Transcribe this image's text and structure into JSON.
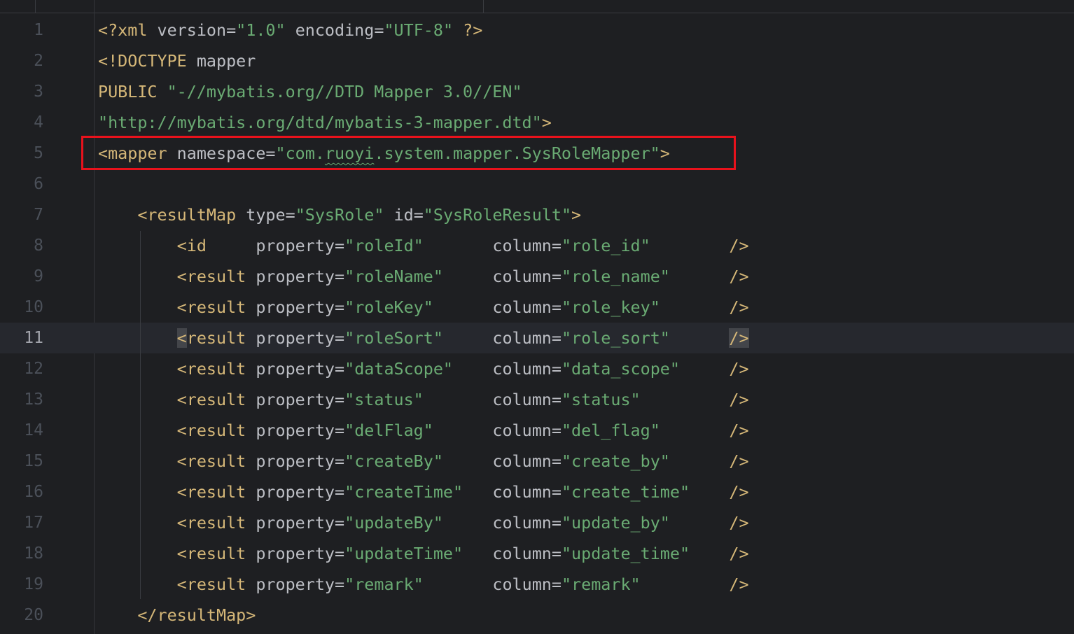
{
  "editor": {
    "lines": [
      {
        "num": "1",
        "tokens": [
          [
            "tag",
            "<?xml "
          ],
          [
            "attr",
            "version"
          ],
          [
            "txt",
            "="
          ],
          [
            "val",
            "\"1.0\""
          ],
          [
            "txt",
            " "
          ],
          [
            "attr",
            "encoding"
          ],
          [
            "txt",
            "="
          ],
          [
            "val",
            "\"UTF-8\""
          ],
          [
            "txt",
            " "
          ],
          [
            "tag",
            "?>"
          ]
        ]
      },
      {
        "num": "2",
        "tokens": [
          [
            "tag",
            "<!DOCTYPE "
          ],
          [
            "txt",
            "mapper"
          ]
        ]
      },
      {
        "num": "3",
        "tokens": [
          [
            "tag",
            "PUBLIC "
          ],
          [
            "val",
            "\"-//mybatis.org//DTD Mapper 3.0//EN\""
          ]
        ]
      },
      {
        "num": "4",
        "tokens": [
          [
            "val",
            "\"http://mybatis.org/dtd/mybatis-3-mapper.dtd\""
          ],
          [
            "tag",
            ">"
          ]
        ]
      },
      {
        "num": "5",
        "tokens": [
          [
            "tag",
            "<mapper "
          ],
          [
            "attr",
            "namespace"
          ],
          [
            "txt",
            "="
          ],
          [
            "val",
            "\"com."
          ],
          [
            "typo",
            "ruoyi"
          ],
          [
            "val",
            ".system.mapper.SysRoleMapper\""
          ],
          [
            "tag",
            ">"
          ]
        ]
      },
      {
        "num": "6",
        "tokens": []
      },
      {
        "num": "7",
        "tokens": [
          [
            "txt",
            "    "
          ],
          [
            "tag",
            "<resultMap "
          ],
          [
            "attr",
            "type"
          ],
          [
            "txt",
            "="
          ],
          [
            "val",
            "\"SysRole\""
          ],
          [
            "txt",
            " "
          ],
          [
            "attr",
            "id"
          ],
          [
            "txt",
            "="
          ],
          [
            "val",
            "\"SysRoleResult\""
          ],
          [
            "tag",
            ">"
          ]
        ]
      },
      {
        "num": "8",
        "tokens": [
          [
            "txt",
            "        "
          ],
          [
            "tag",
            "<id     "
          ],
          [
            "attr",
            "property"
          ],
          [
            "txt",
            "="
          ],
          [
            "val",
            "\"roleId\"       "
          ],
          [
            "attr",
            "column"
          ],
          [
            "txt",
            "="
          ],
          [
            "val",
            "\"role_id\"        "
          ],
          [
            "tag",
            "/>"
          ]
        ]
      },
      {
        "num": "9",
        "tokens": [
          [
            "txt",
            "        "
          ],
          [
            "tag",
            "<result "
          ],
          [
            "attr",
            "property"
          ],
          [
            "txt",
            "="
          ],
          [
            "val",
            "\"roleName\"     "
          ],
          [
            "attr",
            "column"
          ],
          [
            "txt",
            "="
          ],
          [
            "val",
            "\"role_name\"      "
          ],
          [
            "tag",
            "/>"
          ]
        ]
      },
      {
        "num": "10",
        "tokens": [
          [
            "txt",
            "        "
          ],
          [
            "tag",
            "<result "
          ],
          [
            "attr",
            "property"
          ],
          [
            "txt",
            "="
          ],
          [
            "val",
            "\"roleKey\"      "
          ],
          [
            "attr",
            "column"
          ],
          [
            "txt",
            "="
          ],
          [
            "val",
            "\"role_key\"       "
          ],
          [
            "tag",
            "/>"
          ]
        ]
      },
      {
        "num": "11",
        "current": true,
        "tokens": [
          [
            "txt",
            "        "
          ],
          [
            "tagh",
            "<"
          ],
          [
            "tag",
            "result "
          ],
          [
            "attr",
            "property"
          ],
          [
            "txt",
            "="
          ],
          [
            "val",
            "\"roleSort\"     "
          ],
          [
            "attr",
            "column"
          ],
          [
            "txt",
            "="
          ],
          [
            "val",
            "\"role_sort\"      "
          ],
          [
            "tagh",
            "/>"
          ]
        ]
      },
      {
        "num": "12",
        "tokens": [
          [
            "txt",
            "        "
          ],
          [
            "tag",
            "<result "
          ],
          [
            "attr",
            "property"
          ],
          [
            "txt",
            "="
          ],
          [
            "val",
            "\"dataScope\"    "
          ],
          [
            "attr",
            "column"
          ],
          [
            "txt",
            "="
          ],
          [
            "val",
            "\"data_scope\"     "
          ],
          [
            "tag",
            "/>"
          ]
        ]
      },
      {
        "num": "13",
        "tokens": [
          [
            "txt",
            "        "
          ],
          [
            "tag",
            "<result "
          ],
          [
            "attr",
            "property"
          ],
          [
            "txt",
            "="
          ],
          [
            "val",
            "\"status\"       "
          ],
          [
            "attr",
            "column"
          ],
          [
            "txt",
            "="
          ],
          [
            "val",
            "\"status\"         "
          ],
          [
            "tag",
            "/>"
          ]
        ]
      },
      {
        "num": "14",
        "tokens": [
          [
            "txt",
            "        "
          ],
          [
            "tag",
            "<result "
          ],
          [
            "attr",
            "property"
          ],
          [
            "txt",
            "="
          ],
          [
            "val",
            "\"delFlag\"      "
          ],
          [
            "attr",
            "column"
          ],
          [
            "txt",
            "="
          ],
          [
            "val",
            "\"del_flag\"       "
          ],
          [
            "tag",
            "/>"
          ]
        ]
      },
      {
        "num": "15",
        "tokens": [
          [
            "txt",
            "        "
          ],
          [
            "tag",
            "<result "
          ],
          [
            "attr",
            "property"
          ],
          [
            "txt",
            "="
          ],
          [
            "val",
            "\"createBy\"     "
          ],
          [
            "attr",
            "column"
          ],
          [
            "txt",
            "="
          ],
          [
            "val",
            "\"create_by\"      "
          ],
          [
            "tag",
            "/>"
          ]
        ]
      },
      {
        "num": "16",
        "tokens": [
          [
            "txt",
            "        "
          ],
          [
            "tag",
            "<result "
          ],
          [
            "attr",
            "property"
          ],
          [
            "txt",
            "="
          ],
          [
            "val",
            "\"createTime\"   "
          ],
          [
            "attr",
            "column"
          ],
          [
            "txt",
            "="
          ],
          [
            "val",
            "\"create_time\"    "
          ],
          [
            "tag",
            "/>"
          ]
        ]
      },
      {
        "num": "17",
        "tokens": [
          [
            "txt",
            "        "
          ],
          [
            "tag",
            "<result "
          ],
          [
            "attr",
            "property"
          ],
          [
            "txt",
            "="
          ],
          [
            "val",
            "\"updateBy\"     "
          ],
          [
            "attr",
            "column"
          ],
          [
            "txt",
            "="
          ],
          [
            "val",
            "\"update_by\"      "
          ],
          [
            "tag",
            "/>"
          ]
        ]
      },
      {
        "num": "18",
        "tokens": [
          [
            "txt",
            "        "
          ],
          [
            "tag",
            "<result "
          ],
          [
            "attr",
            "property"
          ],
          [
            "txt",
            "="
          ],
          [
            "val",
            "\"updateTime\"   "
          ],
          [
            "attr",
            "column"
          ],
          [
            "txt",
            "="
          ],
          [
            "val",
            "\"update_time\"    "
          ],
          [
            "tag",
            "/>"
          ]
        ]
      },
      {
        "num": "19",
        "tokens": [
          [
            "txt",
            "        "
          ],
          [
            "tag",
            "<result "
          ],
          [
            "attr",
            "property"
          ],
          [
            "txt",
            "="
          ],
          [
            "val",
            "\"remark\"       "
          ],
          [
            "attr",
            "column"
          ],
          [
            "txt",
            "="
          ],
          [
            "val",
            "\"remark\"         "
          ],
          [
            "tag",
            "/>"
          ]
        ]
      },
      {
        "num": "20",
        "tokens": [
          [
            "txt",
            "    "
          ],
          [
            "tag",
            "</resultMap>"
          ]
        ]
      }
    ]
  },
  "colors": {
    "background": "#1e1f22",
    "tag": "#d5b778",
    "attribute": "#bcbec4",
    "string": "#6aab73",
    "line_number": "#4b5059",
    "current_line": "#26282e",
    "highlight_box": "#e8121c"
  }
}
